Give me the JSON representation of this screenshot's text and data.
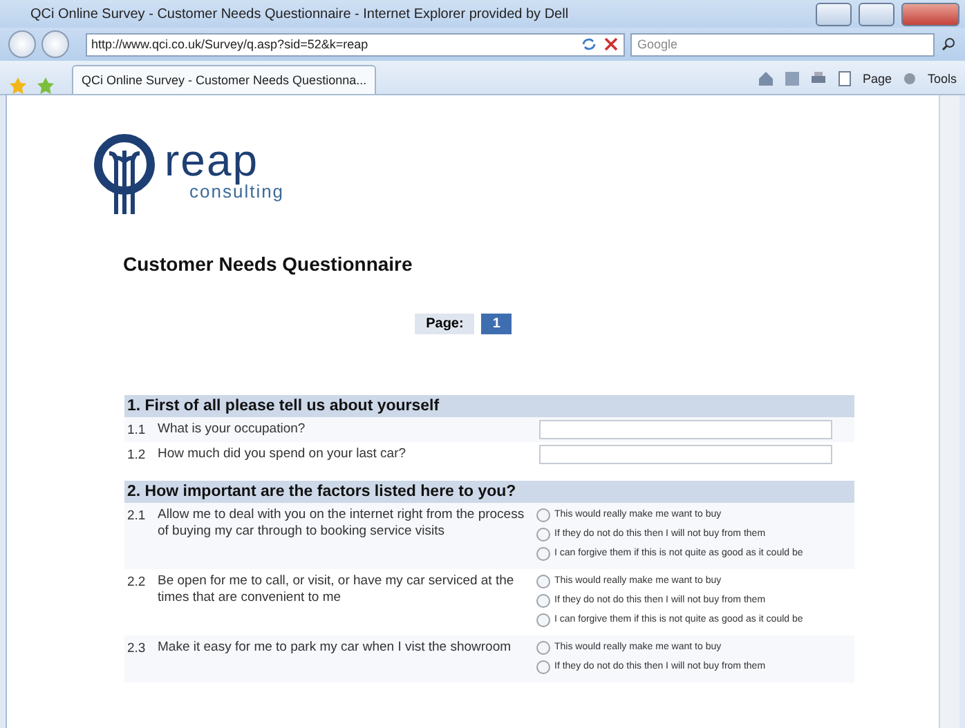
{
  "window": {
    "title": "QCi Online Survey - Customer Needs Questionnaire - Internet Explorer provided by Dell"
  },
  "address_bar": {
    "url": "http://www.qci.co.uk/Survey/q.asp?sid=52&k=reap",
    "search_placeholder": "Google"
  },
  "tabs": [
    {
      "label": "QCi Online Survey - Customer Needs Questionna...",
      "selected": true
    }
  ],
  "toolbar": {
    "page": "Page",
    "tools": "Tools"
  },
  "logo": {
    "name": "reap",
    "tagline": "consulting"
  },
  "heading": "Customer Needs Questionnaire",
  "pager": {
    "label": "Page:",
    "pages": [
      {
        "label": "1",
        "selected": true
      }
    ]
  },
  "sections": [
    {
      "title": "1. First of all please tell us about yourself",
      "questions": [
        {
          "kind": "text",
          "number": "1.1",
          "text": "What is your occupation?"
        },
        {
          "kind": "text",
          "number": "1.2",
          "text": "How much did you spend on your last car?"
        }
      ]
    },
    {
      "title": "2. How important are the factors listed here to you?",
      "questions": [
        {
          "kind": "choice",
          "number": "2.1",
          "text": "Allow me to deal with you on the internet right from the process of buying my car through to booking service visits",
          "options": [
            {
              "label": "This would really make me want to buy",
              "selected": false
            },
            {
              "label": "If they do not do this then I will not buy from them",
              "selected": false
            },
            {
              "label": "I can forgive them if this is not quite as good as it could be",
              "selected": false
            }
          ]
        },
        {
          "kind": "choice",
          "number": "2.2",
          "text": "Be open for me to call, or visit, or have my car serviced at the times that are convenient to me",
          "options": [
            {
              "label": "This would really make me want to buy",
              "selected": false
            },
            {
              "label": "If they do not do this then I will not buy from them",
              "selected": false
            },
            {
              "label": "I can forgive them if this is not quite as good as it could be",
              "selected": false
            }
          ]
        },
        {
          "kind": "choice",
          "number": "2.3",
          "text": "Make it easy for me to park my car when I vist the showroom",
          "options": [
            {
              "label": "This would really make me want to buy",
              "selected": false
            },
            {
              "label": "If they do not do this then I will not buy from them",
              "selected": false
            }
          ]
        }
      ]
    }
  ]
}
